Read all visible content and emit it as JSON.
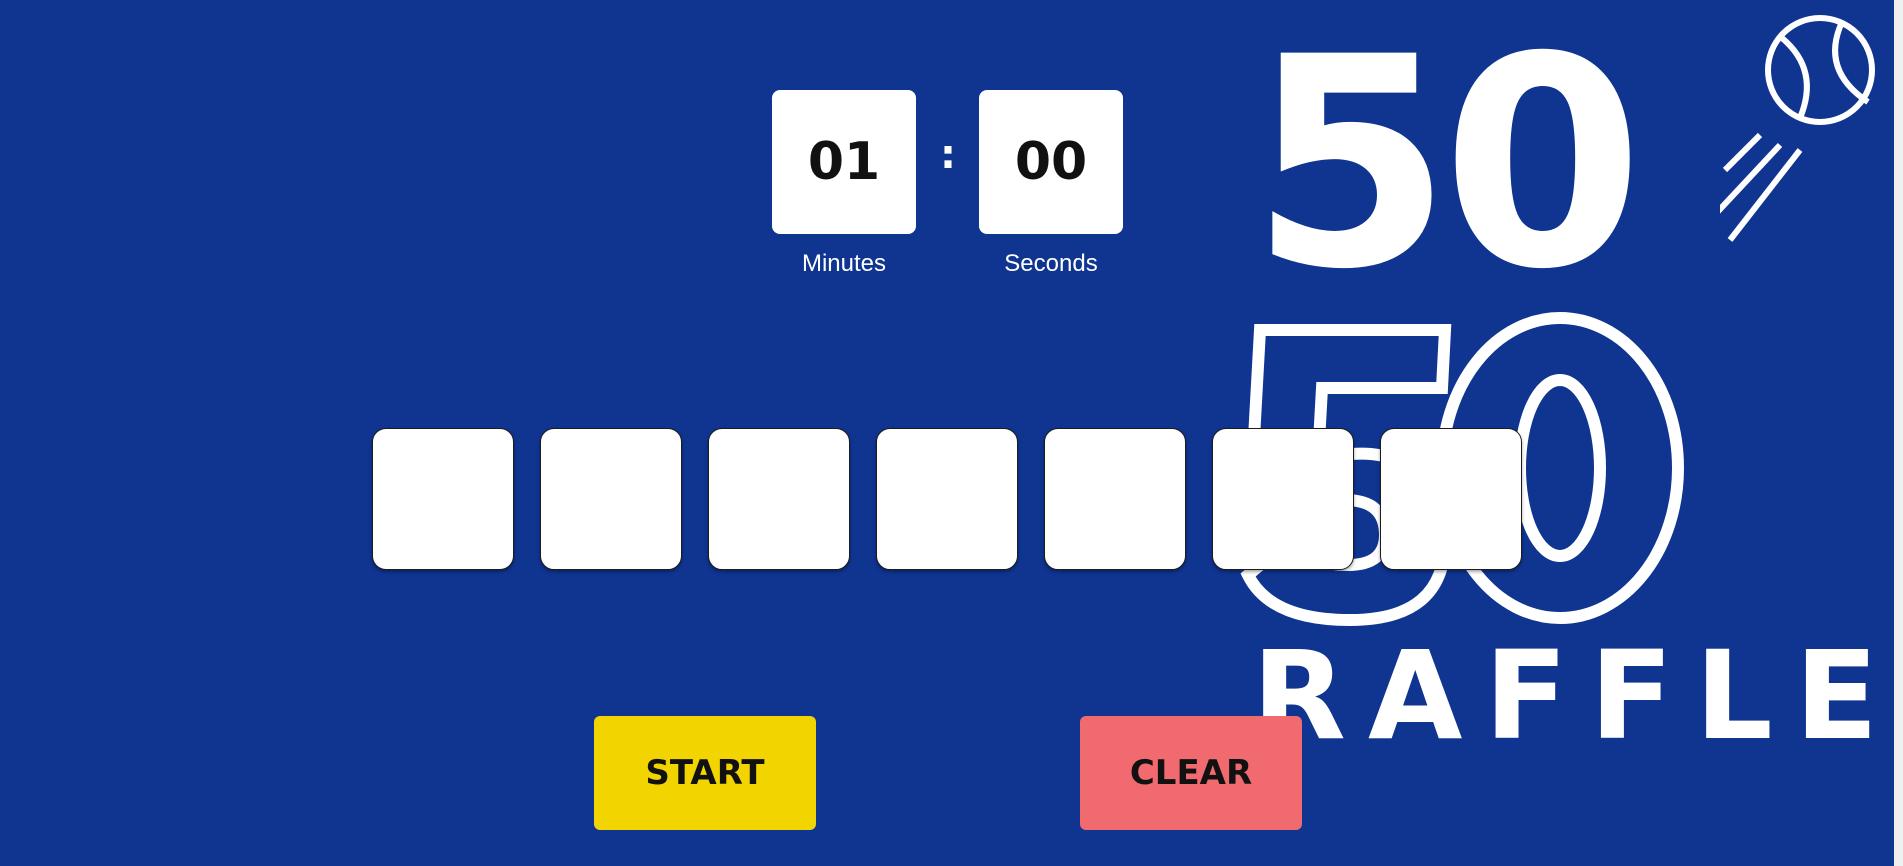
{
  "timer": {
    "minutes": "01",
    "seconds": "00",
    "separator": ":",
    "minutes_label": "Minutes",
    "seconds_label": "Seconds"
  },
  "slots": [
    "",
    "",
    "",
    "",
    "",
    "",
    ""
  ],
  "buttons": {
    "start_label": "START",
    "clear_label": "CLEAR"
  },
  "logo": {
    "top_text": "50",
    "outline_left": "5",
    "outline_right": "0",
    "bottom_text": "RAFFLE"
  },
  "colors": {
    "background": "#0f3591",
    "start_button": "#f2d400",
    "clear_button": "#f06a70",
    "box": "#ffffff"
  }
}
